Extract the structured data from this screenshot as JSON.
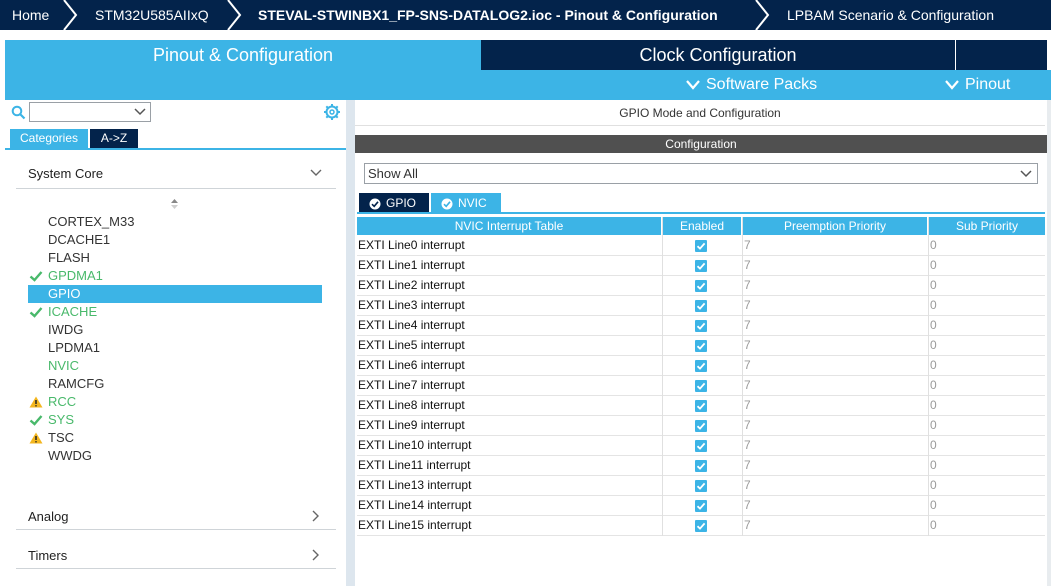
{
  "breadcrumb": [
    {
      "label": "Home"
    },
    {
      "label": "STM32U585AIIxQ"
    },
    {
      "label": "STEVAL-STWINBX1_FP-SNS-DATALOG2.ioc - Pinout & Configuration"
    },
    {
      "label": "LPBAM Scenario & Configuration"
    }
  ],
  "main_tabs": {
    "pinout_config": "Pinout & Configuration",
    "clock_config": "Clock Configuration"
  },
  "sub_menu": {
    "software_packs": "Software Packs",
    "pinout": "Pinout"
  },
  "left": {
    "search_value": "",
    "tab_categories": "Categories",
    "tab_az": "A->Z",
    "section_system_core": "System Core",
    "section_analog": "Analog",
    "section_timers": "Timers",
    "items": [
      {
        "label": "CORTEX_M33",
        "status": "none"
      },
      {
        "label": "DCACHE1",
        "status": "none"
      },
      {
        "label": "FLASH",
        "status": "none"
      },
      {
        "label": "GPDMA1",
        "status": "ok"
      },
      {
        "label": "GPIO",
        "status": "selected"
      },
      {
        "label": "ICACHE",
        "status": "ok"
      },
      {
        "label": "IWDG",
        "status": "none"
      },
      {
        "label": "LPDMA1",
        "status": "none"
      },
      {
        "label": "NVIC",
        "status": "configured"
      },
      {
        "label": "RAMCFG",
        "status": "none"
      },
      {
        "label": "RCC",
        "status": "warning"
      },
      {
        "label": "SYS",
        "status": "ok"
      },
      {
        "label": "TSC",
        "status": "warning"
      },
      {
        "label": "WWDG",
        "status": "none"
      }
    ]
  },
  "right": {
    "title": "GPIO Mode and Configuration",
    "config_header": "Configuration",
    "filter_value": "Show All",
    "subtabs": {
      "gpio": "GPIO",
      "nvic": "NVIC"
    },
    "table": {
      "headers": [
        "NVIC Interrupt Table",
        "Enabled",
        "Preemption Priority",
        "Sub Priority"
      ],
      "rows": [
        {
          "name": "EXTI Line0 interrupt",
          "enabled": true,
          "preemption": "7",
          "sub": "0"
        },
        {
          "name": "EXTI Line1 interrupt",
          "enabled": true,
          "preemption": "7",
          "sub": "0"
        },
        {
          "name": "EXTI Line2 interrupt",
          "enabled": true,
          "preemption": "7",
          "sub": "0"
        },
        {
          "name": "EXTI Line3 interrupt",
          "enabled": true,
          "preemption": "7",
          "sub": "0"
        },
        {
          "name": "EXTI Line4 interrupt",
          "enabled": true,
          "preemption": "7",
          "sub": "0"
        },
        {
          "name": "EXTI Line5 interrupt",
          "enabled": true,
          "preemption": "7",
          "sub": "0"
        },
        {
          "name": "EXTI Line6 interrupt",
          "enabled": true,
          "preemption": "7",
          "sub": "0"
        },
        {
          "name": "EXTI Line7 interrupt",
          "enabled": true,
          "preemption": "7",
          "sub": "0"
        },
        {
          "name": "EXTI Line8 interrupt",
          "enabled": true,
          "preemption": "7",
          "sub": "0"
        },
        {
          "name": "EXTI Line9 interrupt",
          "enabled": true,
          "preemption": "7",
          "sub": "0"
        },
        {
          "name": "EXTI Line10 interrupt",
          "enabled": true,
          "preemption": "7",
          "sub": "0"
        },
        {
          "name": "EXTI Line11 interrupt",
          "enabled": true,
          "preemption": "7",
          "sub": "0"
        },
        {
          "name": "EXTI Line13 interrupt",
          "enabled": true,
          "preemption": "7",
          "sub": "0"
        },
        {
          "name": "EXTI Line14 interrupt",
          "enabled": true,
          "preemption": "7",
          "sub": "0"
        },
        {
          "name": "EXTI Line15 interrupt",
          "enabled": true,
          "preemption": "7",
          "sub": "0"
        }
      ]
    }
  },
  "colors": {
    "navy": "#03234b",
    "accent": "#3cb4e6",
    "ok_green": "#49b96b",
    "warning_yellow": "#f3b61f"
  }
}
